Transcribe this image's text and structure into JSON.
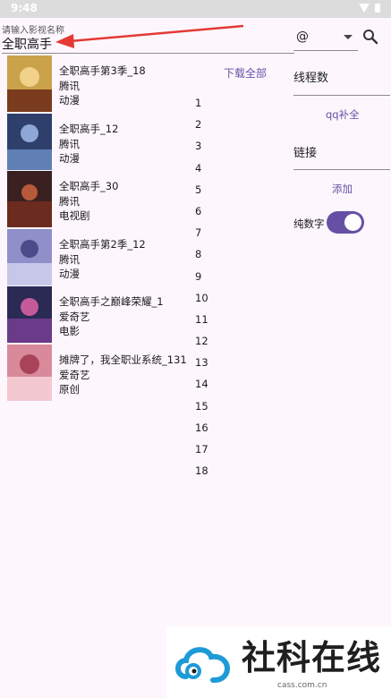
{
  "status": {
    "time": "9:48"
  },
  "search": {
    "hint": "请输入影视名称",
    "value": "全职高手"
  },
  "source_select": {
    "value": "@"
  },
  "download_all_label": "下载全部",
  "results": [
    {
      "title": "全职高手第3季_18",
      "source": "腾讯",
      "genre": "动漫",
      "poster_color": "#c9a24a"
    },
    {
      "title": "全职高手_12",
      "source": "腾讯",
      "genre": "动漫",
      "poster_color": "#2f3f6b"
    },
    {
      "title": "全职高手_30",
      "source": "腾讯",
      "genre": "电视剧",
      "poster_color": "#3a2020"
    },
    {
      "title": "全职高手第2季_12",
      "source": "腾讯",
      "genre": "动漫",
      "poster_color": "#8f8fc9"
    },
    {
      "title": "全职高手之巅峰荣耀_1",
      "source": "爱奇艺",
      "genre": "电影",
      "poster_color": "#2a2a55"
    },
    {
      "title": "摊牌了，我全职业系统_131",
      "source": "爱奇艺",
      "genre": "原创",
      "poster_color": "#d98a9a"
    }
  ],
  "episode_numbers": [
    "1",
    "2",
    "3",
    "4",
    "5",
    "6",
    "7",
    "8",
    "9",
    "10",
    "11",
    "12",
    "13",
    "14",
    "15",
    "16",
    "17",
    "18"
  ],
  "right_panel": {
    "threads_label": "线程数",
    "qq_fill_label": "qq补全",
    "link_label": "链接",
    "add_label": "添加",
    "pure_number_label": "纯数字",
    "pure_number_on": true
  },
  "watermark": {
    "name": "社科在线",
    "url": "cass.com.cn"
  },
  "colors": {
    "accent": "#6750a4",
    "annotation_arrow": "#e53935",
    "background": "#fdf7fd"
  }
}
